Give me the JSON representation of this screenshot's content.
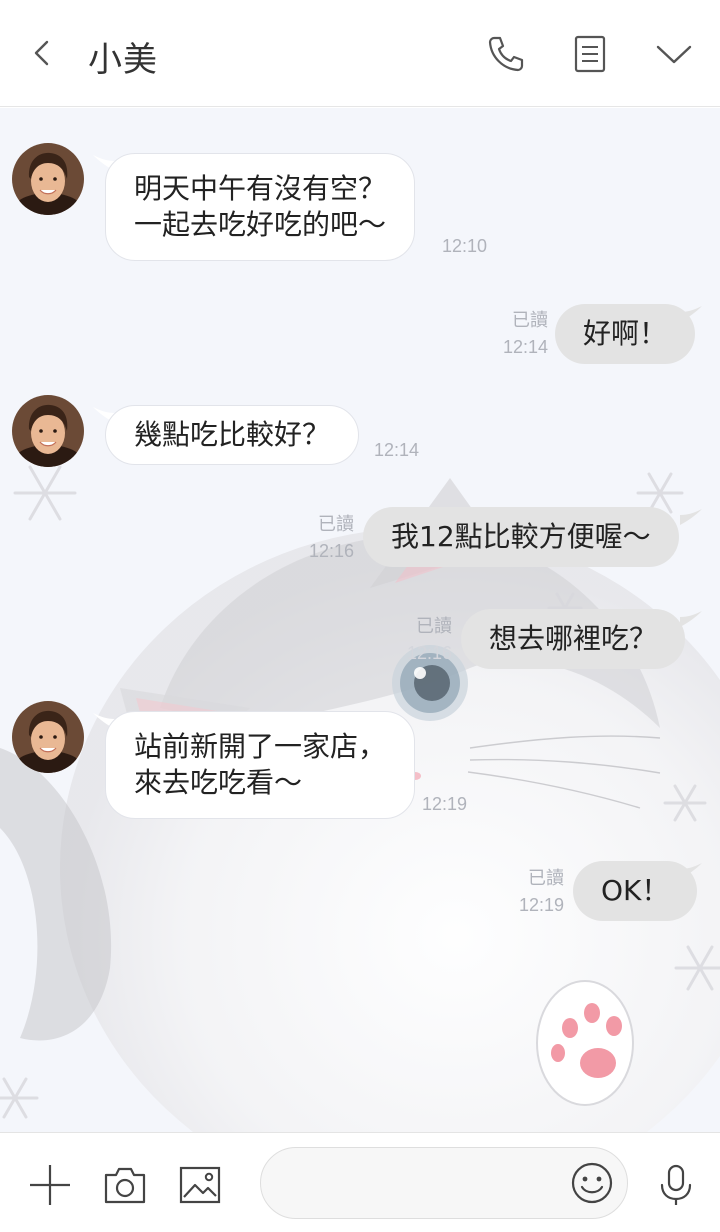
{
  "header": {
    "title": "小美",
    "icons": [
      "chevron-left-icon",
      "phone-icon",
      "notes-icon",
      "chevron-down-icon"
    ]
  },
  "messages": [
    {
      "side": "in",
      "lines": [
        "明天中午有沒有空？",
        "一起去吃好吃的吧～"
      ],
      "time": "12:10"
    },
    {
      "side": "out",
      "text": "好啊！",
      "read": "已讀",
      "time": "12:14"
    },
    {
      "side": "in",
      "lines": [
        "幾點吃比較好？"
      ],
      "time": "12:14"
    },
    {
      "side": "out",
      "text": "我12點比較方便喔～",
      "read": "已讀",
      "time": "12:16"
    },
    {
      "side": "out",
      "text": "想去哪裡吃？",
      "read": "已讀",
      "time": "12:16"
    },
    {
      "side": "in",
      "lines": [
        "站前新開了一家店，",
        "來去吃吃看～"
      ],
      "time": "12:19"
    },
    {
      "side": "out",
      "text": "OK！",
      "read": "已讀",
      "time": "12:19"
    }
  ],
  "input_bar": {
    "message_value": "",
    "icons": [
      "plus-icon",
      "camera-icon",
      "image-icon",
      "smiley-icon",
      "microphone-icon"
    ]
  },
  "colors": {
    "chat_background": "#f4f6fb",
    "incoming_bubble": "#ffffff",
    "outgoing_bubble": "#e3e3e3",
    "meta_text": "#b0b3bb"
  }
}
